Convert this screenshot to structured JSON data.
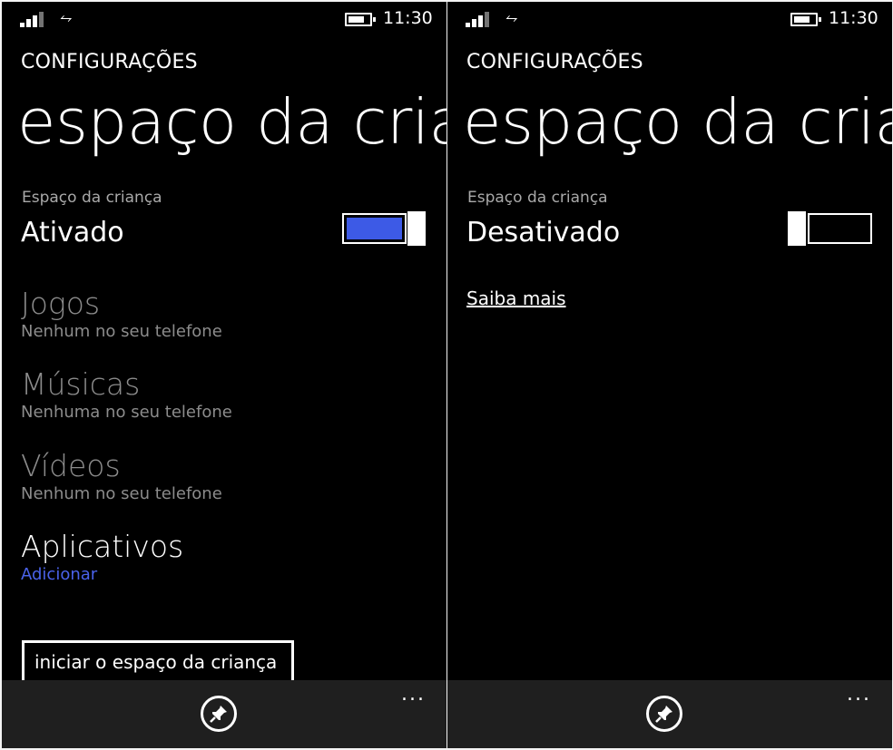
{
  "status": {
    "time": "11:30"
  },
  "header": {
    "section": "CONFIGURAÇÕES",
    "title": "espaço da criança"
  },
  "left": {
    "toggle_label": "Espaço da criança",
    "toggle_value": "Ativado",
    "toggle_state": "on",
    "items": [
      {
        "title": "Jogos",
        "sub": "Nenhum no seu telefone"
      },
      {
        "title": "Músicas",
        "sub": "Nenhuma no seu telefone"
      },
      {
        "title": "Vídeos",
        "sub": "Nenhum no seu telefone"
      },
      {
        "title": "Aplicativos",
        "sub": "Adicionar"
      }
    ],
    "start_button": "iniciar o espaço da criança"
  },
  "right": {
    "toggle_label": "Espaço da criança",
    "toggle_value": "Desativado",
    "toggle_state": "off",
    "learn_more": "Saiba mais"
  },
  "appbar": {
    "more": "..."
  },
  "colors": {
    "accent": "#3d5ae6",
    "background": "#000000",
    "appbar": "#1f1f1f",
    "dim_text": "#8c8c8c"
  },
  "icons": [
    "signal-icon",
    "wifi-icon",
    "battery-icon",
    "pin-icon",
    "more-icon"
  ]
}
